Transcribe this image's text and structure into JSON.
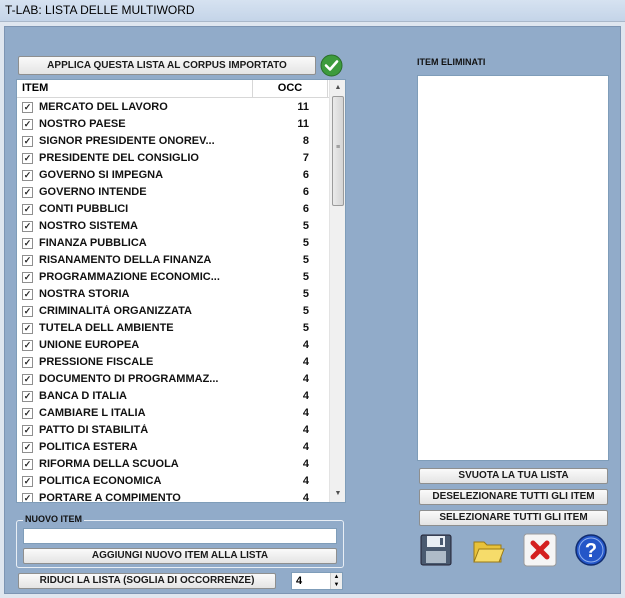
{
  "window": {
    "title": "T-LAB: LISTA DELLE MULTIWORD"
  },
  "left": {
    "apply_button": "APPLICA QUESTA LISTA AL CORPUS IMPORTATO",
    "columns": {
      "item": "ITEM",
      "occ": "OCC"
    },
    "items": [
      {
        "label": "MERCATO DEL LAVORO",
        "occ": "11"
      },
      {
        "label": "NOSTRO PAESE",
        "occ": "11"
      },
      {
        "label": "SIGNOR PRESIDENTE ONOREV...",
        "occ": "8"
      },
      {
        "label": "PRESIDENTE DEL CONSIGLIO",
        "occ": "7"
      },
      {
        "label": "GOVERNO SI IMPEGNA",
        "occ": "6"
      },
      {
        "label": "GOVERNO INTENDE",
        "occ": "6"
      },
      {
        "label": "CONTI PUBBLICI",
        "occ": "6"
      },
      {
        "label": "NOSTRO SISTEMA",
        "occ": "5"
      },
      {
        "label": "FINANZA PUBBLICA",
        "occ": "5"
      },
      {
        "label": "RISANAMENTO DELLA FINANZA",
        "occ": "5"
      },
      {
        "label": "PROGRAMMAZIONE ECONOMIC...",
        "occ": "5"
      },
      {
        "label": "NOSTRA STORIA",
        "occ": "5"
      },
      {
        "label": "CRIMINALITÀ ORGANIZZATA",
        "occ": "5"
      },
      {
        "label": "TUTELA DELL AMBIENTE",
        "occ": "5"
      },
      {
        "label": "UNIONE EUROPEA",
        "occ": "4"
      },
      {
        "label": "PRESSIONE FISCALE",
        "occ": "4"
      },
      {
        "label": "DOCUMENTO DI PROGRAMMAZ...",
        "occ": "4"
      },
      {
        "label": "BANCA D ITALIA",
        "occ": "4"
      },
      {
        "label": "CAMBIARE L ITALIA",
        "occ": "4"
      },
      {
        "label": "PATTO DI STABILITÀ",
        "occ": "4"
      },
      {
        "label": "POLITICA ESTERA",
        "occ": "4"
      },
      {
        "label": "RIFORMA DELLA SCUOLA",
        "occ": "4"
      },
      {
        "label": "POLITICA ECONOMICA",
        "occ": "4"
      },
      {
        "label": "PORTARE A COMPIMENTO",
        "occ": "4"
      }
    ],
    "new_item": {
      "group_label": "NUOVO ITEM",
      "input_value": "",
      "add_button": "AGGIUNGI NUOVO ITEM ALLA LISTA"
    },
    "reduce": {
      "button": "RIDUCI LA LISTA  (SOGLIA DI OCCORRENZE)",
      "threshold": "4"
    }
  },
  "right": {
    "eliminated_title": "ITEM ELIMINATI",
    "eliminated_items": [],
    "buttons": {
      "empty": "SVUOTA LA TUA LISTA",
      "deselect_all": "DESELEZIONARE TUTTI GLI ITEM",
      "select_all": "SELEZIONARE TUTTI GLI ITEM"
    },
    "icons": [
      "save-icon",
      "folder-icon",
      "cancel-icon",
      "help-icon"
    ]
  },
  "colors": {
    "background": "#91abc9",
    "accent_green": "#3d9b3d",
    "cancel_red": "#d42020",
    "help_blue": "#2456c8"
  }
}
